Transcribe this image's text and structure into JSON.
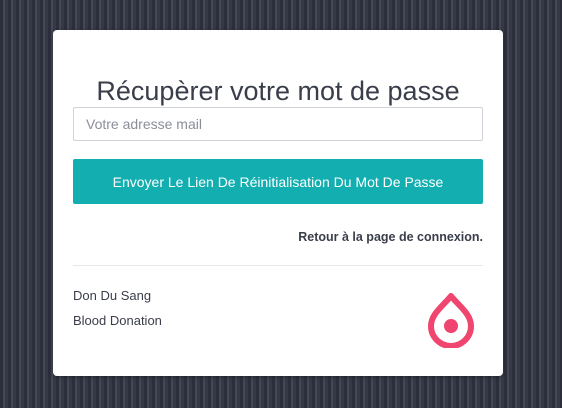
{
  "recovery_form": {
    "title": "Récupèrer votre mot de passe",
    "email_placeholder": "Votre adresse mail",
    "email_value": "",
    "submit_label": "Envoyer Le Lien De Réinitialisation Du Mot De Passe",
    "back_link_label": "Retour à la page de connexion."
  },
  "footer": {
    "line1": "Don Du Sang",
    "line2": "Blood Donation",
    "logo_icon": "blood-drop-icon"
  },
  "colors": {
    "accent": "#12aeb0",
    "logo": "#f0456f",
    "text": "#3a3e4a"
  }
}
